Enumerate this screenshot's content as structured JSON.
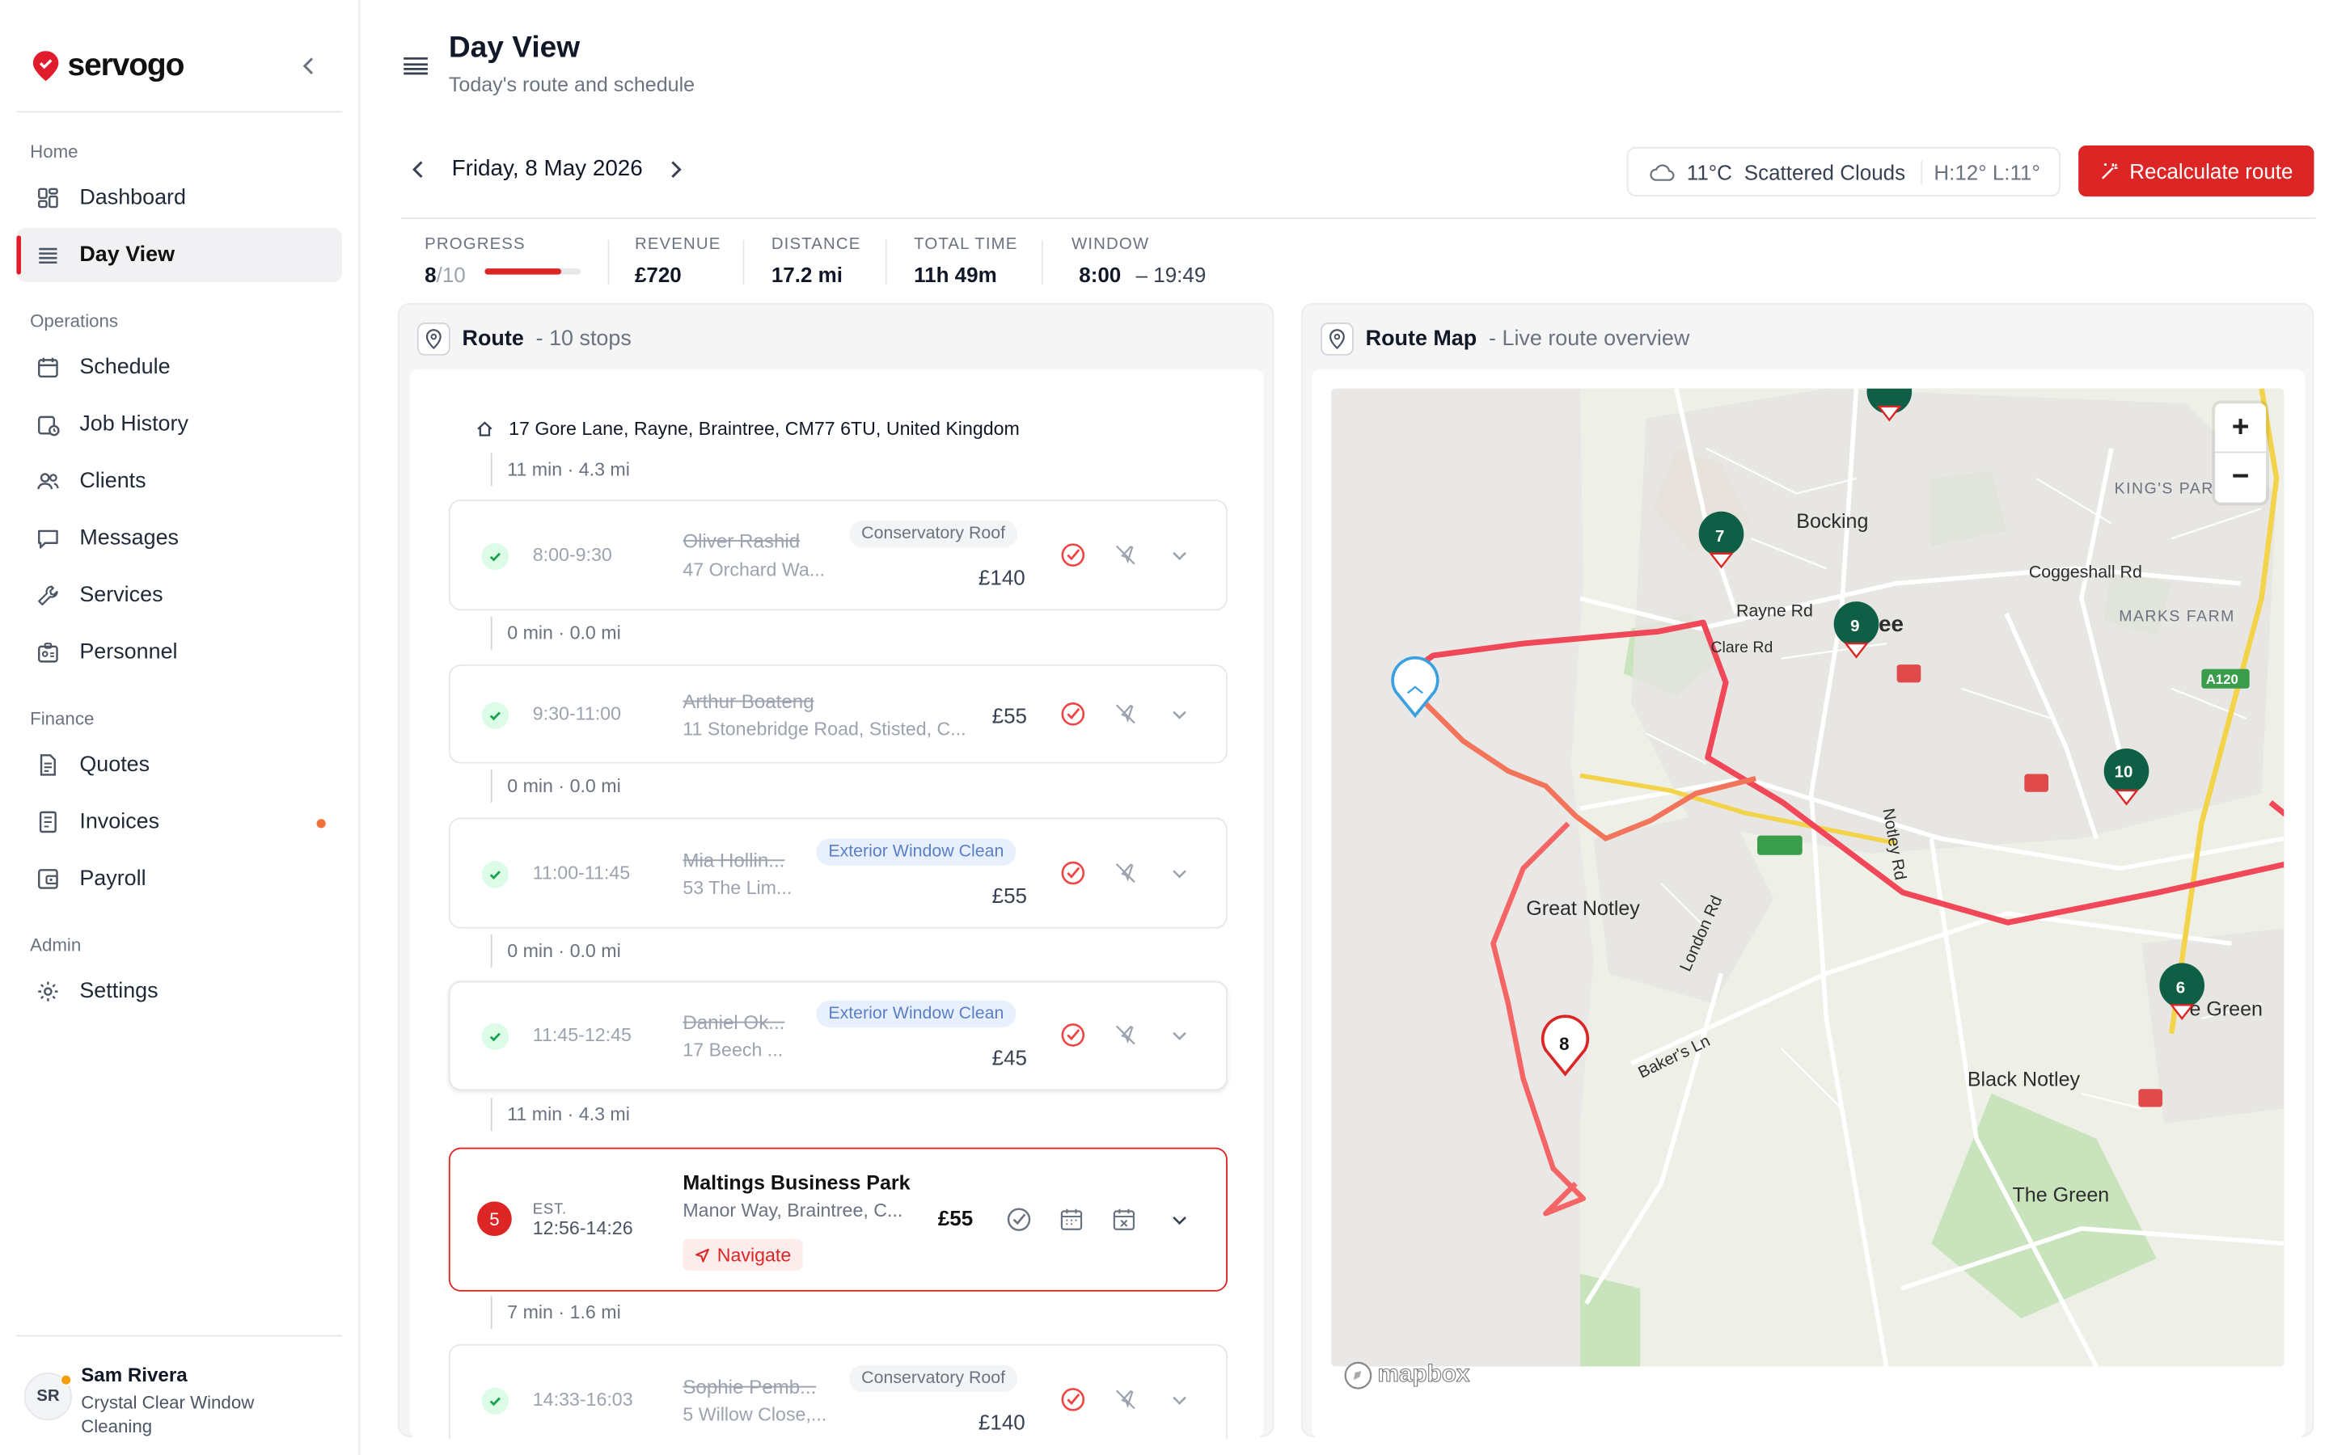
{
  "app": {
    "brand": "servogo"
  },
  "sidebar": {
    "sections": [
      {
        "label": "Home",
        "items": [
          {
            "label": "Dashboard"
          },
          {
            "label": "Day View",
            "active": true
          }
        ]
      },
      {
        "label": "Operations",
        "items": [
          {
            "label": "Schedule"
          },
          {
            "label": "Job History"
          },
          {
            "label": "Clients"
          },
          {
            "label": "Messages"
          },
          {
            "label": "Services"
          },
          {
            "label": "Personnel"
          }
        ]
      },
      {
        "label": "Finance",
        "items": [
          {
            "label": "Quotes"
          },
          {
            "label": "Invoices"
          },
          {
            "label": "Payroll"
          }
        ]
      },
      {
        "label": "Admin",
        "items": [
          {
            "label": "Settings"
          }
        ]
      }
    ],
    "user": {
      "initials": "SR",
      "name": "Sam Rivera",
      "org": "Crystal Clear Window Cleaning"
    }
  },
  "header": {
    "title": "Day View",
    "subtitle": "Today's route and schedule"
  },
  "date": "Friday, 8 May 2026",
  "weather": {
    "temp": "11°C",
    "desc": "Scattered Clouds",
    "hilo": "H:12° L:11°"
  },
  "recalc_label": "Recalculate route",
  "stats": {
    "progress": {
      "label": "Progress",
      "done": "8",
      "total": "/10",
      "fraction": 0.8
    },
    "revenue": {
      "label": "Revenue",
      "value": "£720"
    },
    "distance": {
      "label": "Distance",
      "value": "17.2 mi"
    },
    "total_time": {
      "label": "Total time",
      "value": "11h 49m"
    },
    "window": {
      "label": "Window",
      "start": "8:00",
      "end": "– 19:49"
    }
  },
  "route": {
    "title": "Route",
    "subtitle": "- 10 stops",
    "home": "17 Gore Lane, Rayne, Braintree, CM77 6TU, United Kingdom",
    "gaps": [
      "11 min · 4.3 mi",
      "0 min · 0.0 mi",
      "0 min · 0.0 mi",
      "0 min · 0.0 mi",
      "11 min · 4.3 mi",
      "7 min · 1.6 mi"
    ],
    "stops": [
      {
        "time": "8:00-9:30",
        "name": "Oliver Rashid",
        "addr": "47 Orchard Wa...",
        "tag": "Conservatory Roof",
        "price": "£140"
      },
      {
        "time": "9:30-11:00",
        "name": "Arthur Boateng",
        "addr": "11 Stonebridge Road, Stisted, C...",
        "tag": "",
        "price": "£55"
      },
      {
        "time": "11:00-11:45",
        "name": "Mia Hollin...",
        "addr": "53 The Lim...",
        "tag": "Exterior Window Clean",
        "price": "£55"
      },
      {
        "time": "11:45-12:45",
        "name": "Daniel Ok...",
        "addr": "17 Beech ...",
        "tag": "Exterior Window Clean",
        "price": "£45"
      },
      {
        "time": "14:33-16:03",
        "name": "Sophie Pemb...",
        "addr": "5 Willow Close,...",
        "tag": "Conservatory Roof",
        "price": "£140"
      }
    ],
    "current": {
      "number": "5",
      "est": "EST.",
      "time": "12:56-14:26",
      "name": "Maltings Business Park",
      "addr": "Manor Way, Braintree, C...",
      "price": "£55",
      "navigate": "Navigate"
    }
  },
  "map": {
    "title": "Route Map",
    "subtitle": "- Live route overview",
    "places": [
      "Bocking",
      "Rayne Rd",
      "Clare Rd",
      "Coggeshall Rd",
      "KING'S PAR",
      "MARKS FARM",
      "Great Notley",
      "London Rd",
      "Notley Rd",
      "Baker's Ln",
      "Black Notley",
      "The Green",
      "e Green",
      "A120",
      "tree"
    ],
    "markers": [
      "7",
      "9",
      "10",
      "8",
      "6"
    ],
    "attribution": "mapbox"
  },
  "colors": {
    "accent": "#dc2626",
    "done_green": "#16a34a",
    "route": "#f04858",
    "marker_green": "#0f5e46"
  }
}
